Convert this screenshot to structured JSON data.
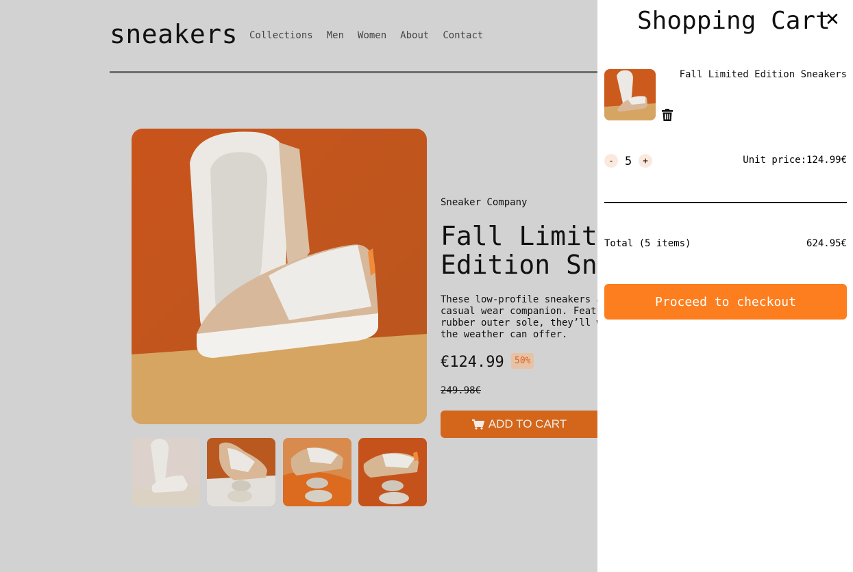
{
  "header": {
    "logo": "sneakers",
    "nav": [
      "Collections",
      "Men",
      "Women",
      "About",
      "Contact"
    ]
  },
  "product": {
    "company": "Sneaker Company",
    "title": "Fall Limited\nEdition Snea",
    "description": "These low-profile sneakers ar\ncasual wear companion. Featur\nrubber outer sole, they’ll wi\nthe weather can offer.",
    "price": "€124.99",
    "discount": "50%",
    "old_price": "249.98€",
    "add_to_cart": "ADD TO CART",
    "thumbnail_count": 4
  },
  "cart": {
    "title": "Shopping Cart",
    "close_icon": "close-icon",
    "item": {
      "name": "Fall Limited Edition Sneakers",
      "minus": "-",
      "quantity": "5",
      "plus": "+",
      "unit_price": "Unit price:124.99€"
    },
    "total_label": "Total (5 items)",
    "total_value": "624.95€",
    "checkout": "Proceed to checkout"
  },
  "colors": {
    "accent": "#fd7e1e",
    "accent_dim": "#d4661c",
    "overlay_bg": "#d2d2d2"
  }
}
